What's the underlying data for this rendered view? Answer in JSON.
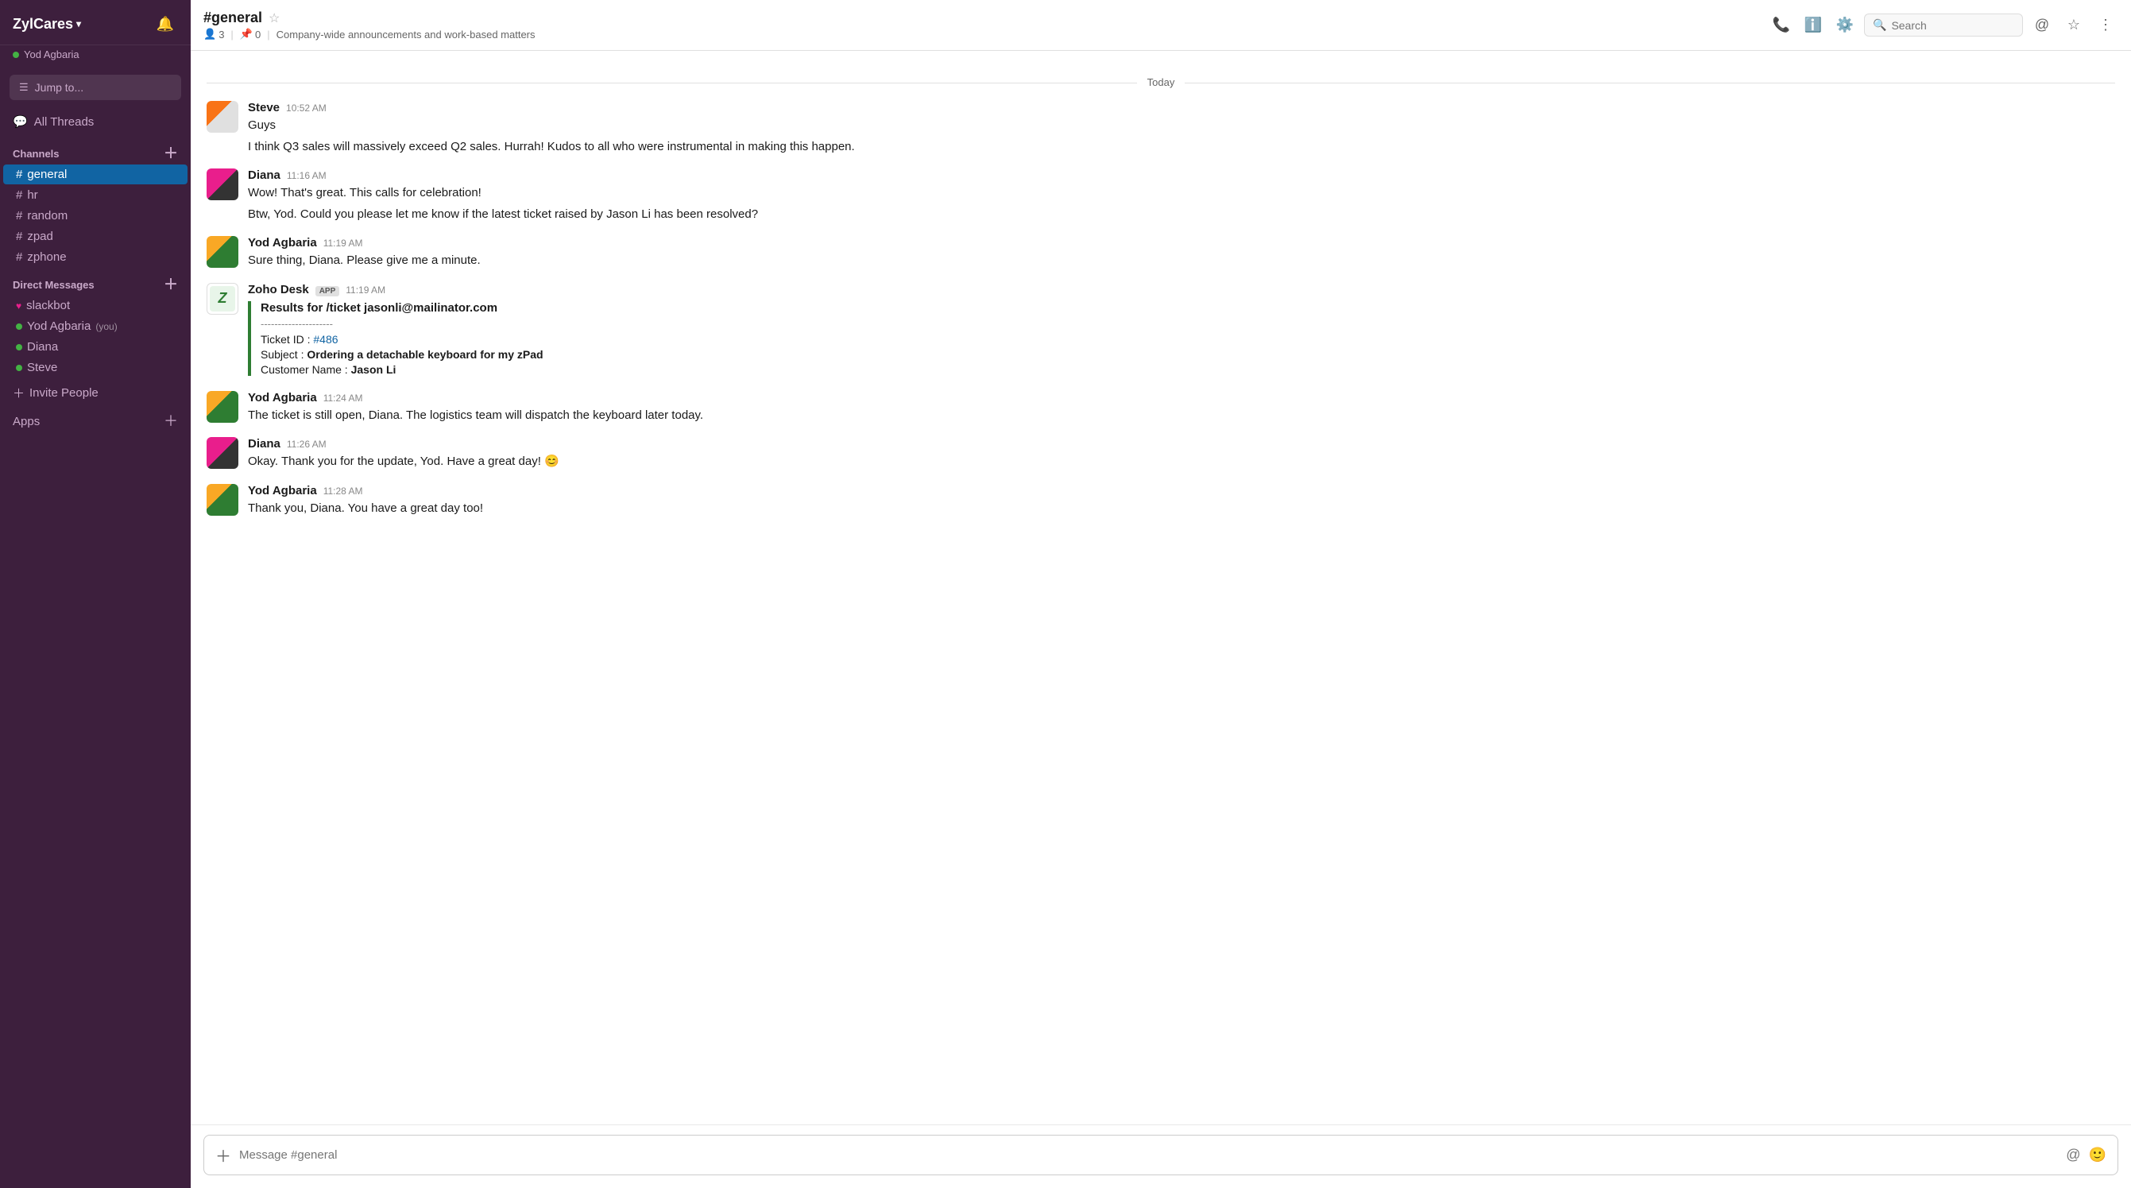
{
  "workspace": {
    "name": "ZylCares",
    "chevron": "▾"
  },
  "user": {
    "name": "Yod Agbaria",
    "status": "online"
  },
  "sidebar": {
    "jump_to": "Jump to...",
    "all_threads": "All Threads",
    "channels_label": "Channels",
    "channels": [
      {
        "name": "general",
        "active": true
      },
      {
        "name": "hr",
        "active": false
      },
      {
        "name": "random",
        "active": false
      },
      {
        "name": "zpad",
        "active": false
      },
      {
        "name": "zphone",
        "active": false
      }
    ],
    "direct_messages_label": "Direct Messages",
    "direct_messages": [
      {
        "name": "slackbot",
        "status": "heart",
        "you": false
      },
      {
        "name": "Yod Agbaria",
        "status": "online",
        "you": true
      },
      {
        "name": "Diana",
        "status": "online",
        "you": false
      },
      {
        "name": "Steve",
        "status": "online",
        "you": false
      }
    ],
    "invite_people": "Invite People",
    "apps": "Apps"
  },
  "channel": {
    "name": "#general",
    "members": "3",
    "pins": "0",
    "description": "Company-wide announcements and work-based matters"
  },
  "header": {
    "search_placeholder": "Search"
  },
  "messages": {
    "date_label": "Today",
    "items": [
      {
        "id": "msg1",
        "sender": "Steve",
        "time": "10:52 AM",
        "avatar_type": "steve",
        "lines": [
          "Guys",
          "I think Q3 sales will massively exceed Q2 sales. Hurrah! Kudos to all who were instrumental in making this happen."
        ]
      },
      {
        "id": "msg2",
        "sender": "Diana",
        "time": "11:16 AM",
        "avatar_type": "diana",
        "lines": [
          "Wow! That's great. This calls for celebration!",
          "Btw, Yod. Could you please let me know if the latest ticket raised by Jason Li has been resolved?"
        ]
      },
      {
        "id": "msg3",
        "sender": "Yod Agbaria",
        "time": "11:19 AM",
        "avatar_type": "yod",
        "lines": [
          "Sure thing, Diana. Please give me a minute."
        ]
      },
      {
        "id": "msg4",
        "sender": "Zoho Desk",
        "is_app": true,
        "time": "11:19 AM",
        "avatar_type": "zoho",
        "lines": [],
        "card": {
          "title": "Results for /ticket jasonli@mailinator.com",
          "divider": "---------------------",
          "ticket_id_label": "Ticket ID : ",
          "ticket_id": "#486",
          "subject_label": "Subject : ",
          "subject": "Ordering a detachable keyboard for my zPad",
          "customer_label": "Customer Name : ",
          "customer": "Jason Li"
        }
      },
      {
        "id": "msg5",
        "sender": "Yod Agbaria",
        "time": "11:24 AM",
        "avatar_type": "yod",
        "lines": [
          "The ticket is still open, Diana. The logistics team will dispatch the keyboard later today."
        ]
      },
      {
        "id": "msg6",
        "sender": "Diana",
        "time": "11:26 AM",
        "avatar_type": "diana",
        "lines": [
          "Okay. Thank you for the update, Yod. Have a great day! 😊"
        ]
      },
      {
        "id": "msg7",
        "sender": "Yod Agbaria",
        "time": "11:28 AM",
        "avatar_type": "yod",
        "lines": [
          "Thank you, Diana. You have a great day too!"
        ]
      }
    ]
  },
  "input": {
    "placeholder": "Message #general"
  }
}
